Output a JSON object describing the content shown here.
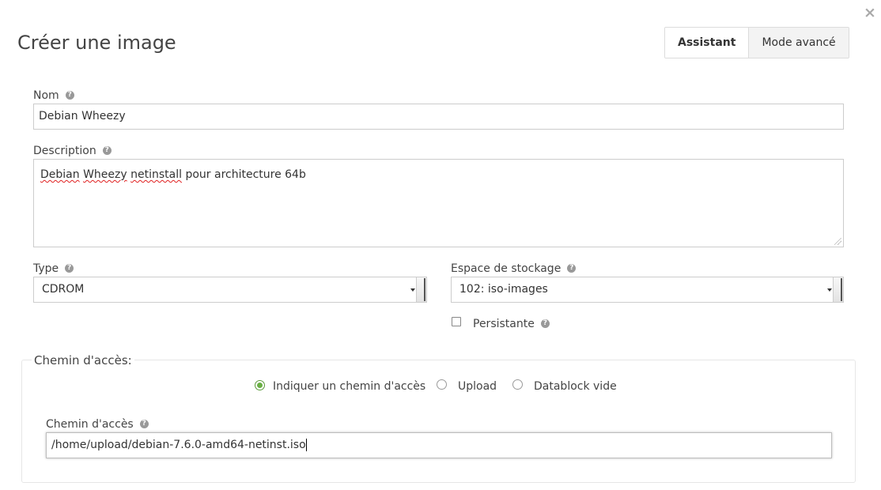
{
  "dialog": {
    "title": "Créer une image",
    "close_glyph": "×"
  },
  "modes": {
    "assistant": "Assistant",
    "advanced": "Mode avancé",
    "active": "assistant"
  },
  "form": {
    "name": {
      "label": "Nom",
      "value": "Debian Wheezy"
    },
    "description": {
      "label": "Description",
      "value_words": [
        "Debian",
        "Wheezy",
        "netinstall",
        "pour architecture 64b"
      ]
    },
    "type": {
      "label": "Type",
      "selected": "CDROM"
    },
    "datastore": {
      "label": "Espace de stockage",
      "selected": "102: iso-images"
    },
    "persistent": {
      "label": "Persistante",
      "checked": false
    }
  },
  "path_section": {
    "legend": "Chemin d'accès:",
    "radios": [
      {
        "label": "Indiquer un chemin d'accès",
        "checked": true
      },
      {
        "label": "Upload",
        "checked": false
      },
      {
        "label": "Datablock vide",
        "checked": false
      }
    ],
    "path_field": {
      "label": "Chemin d'accès",
      "value": "/home/upload/debian-7.6.0-amd64-netinst.iso"
    }
  },
  "icons": {
    "help": "?"
  }
}
